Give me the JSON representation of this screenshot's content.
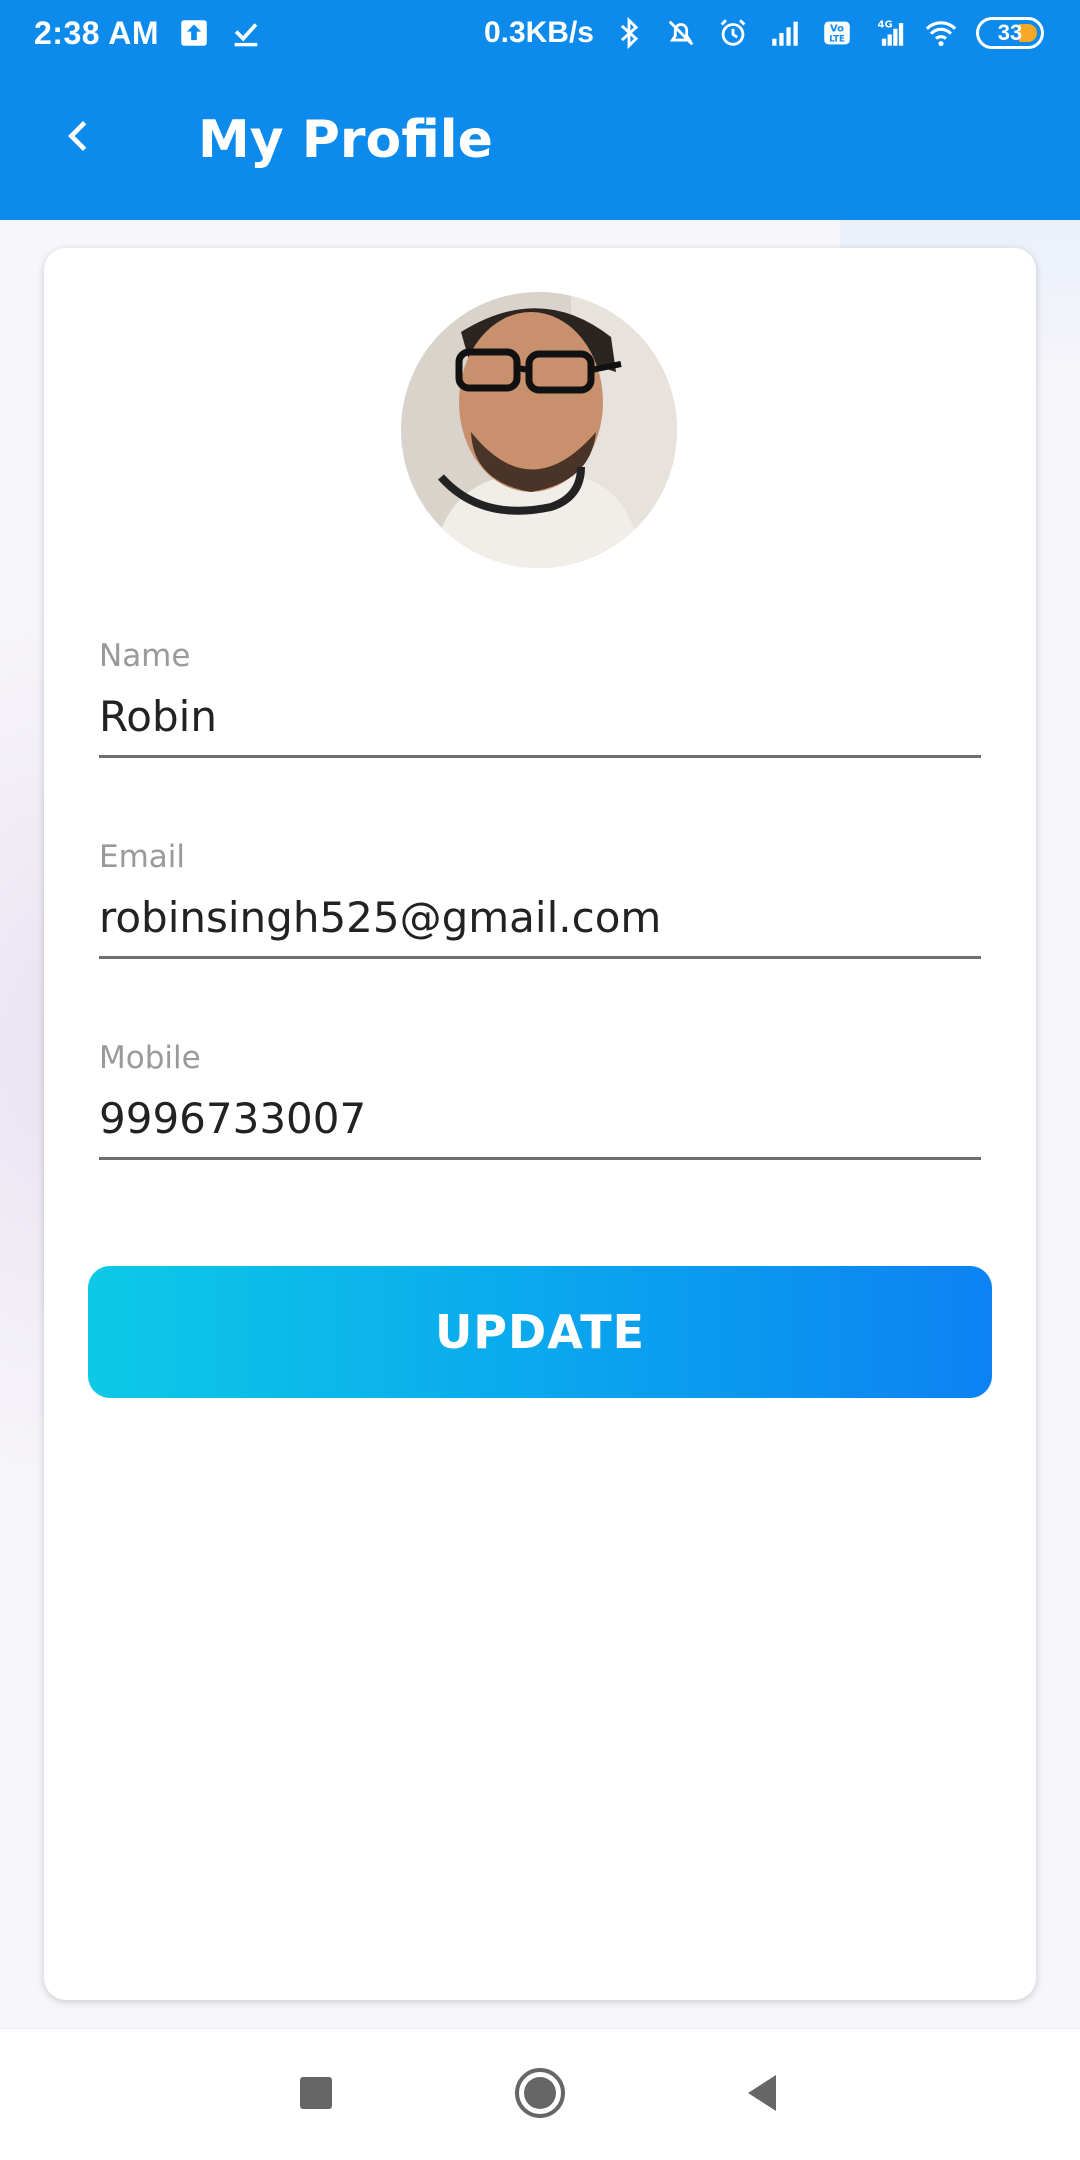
{
  "status_bar": {
    "time": "2:38 AM",
    "network_speed": "0.3KB/s",
    "battery_level": "33",
    "icons": [
      "upload-icon",
      "check-icon",
      "bluetooth-icon",
      "bell-muted-icon",
      "alarm-icon",
      "signal-icon",
      "volte-icon",
      "signal-4g-icon",
      "wifi-icon"
    ]
  },
  "app_bar": {
    "title": "My Profile",
    "back_icon": "chevron-left-icon"
  },
  "profile": {
    "fields": {
      "name": {
        "label": "Name",
        "value": "Robin"
      },
      "email": {
        "label": "Email",
        "value": "robinsingh525@gmail.com"
      },
      "mobile": {
        "label": "Mobile",
        "value": "9996733007"
      }
    },
    "update_label": "UPDATE"
  },
  "colors": {
    "app_bar": "#0d8bec",
    "button_gradient_start": "#0ec9e6",
    "button_gradient_end": "#0c82f3"
  },
  "nav_bar": {
    "icons": [
      "recents-square-icon",
      "home-circle-icon",
      "back-triangle-icon"
    ]
  }
}
